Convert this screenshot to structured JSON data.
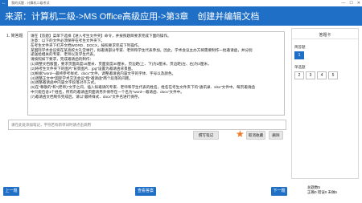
{
  "window": {
    "back_glyph": "←",
    "title": "我的试题 - 计算机二级考试",
    "minimize": "—",
    "maximize": "☐",
    "close": "✕"
  },
  "header": {
    "title": "来源：计算机二级->MS Office高级应用->第3章　创建并编辑文档"
  },
  "question": {
    "number": "1. 简答题",
    "lines": [
      "请在【答题】菜单下选择【进入考生文件夹】命令，并按照题目要求完成下面的操作。",
      "注意：以下的文件必须保存在考生文件夹下。",
      "在考生文件夹下打开文档WORD．DOCX，按照要求完成下列操作。",
      "某国际学术会议将在某高校大礼堂举行，拟邀请部分专家、老师和学生代表参加。因此，学术会议主办方将需要制作一批邀请函，并分别",
      "递送给相关的专家、老师以及学生代表。",
      "请按照如下要求，完成邀请函的制作：",
      "(1)调整文档版面，要求页面高度18厘米、页面宽度30厘米，页边距(上、下)为2厘米，页边距(左、右)为3厘米。",
      "(2)将考生文件夹下的图片\"背景图片．jpg\"设置为邀请函背景图。",
      "(3)根据\"word—最终参考样式．docx\"文件，调整邀请函内容文字的字体、字号以及颜色。",
      "(4)调整正文中\"国际学术交流会议\"和\"邀请函\"两个段落的间距。",
      "(5)调整邀请函中内容文字段落对齐方式。",
      "(6)在\"尊敬的\"和\"(老师)\"文字之间，插入拟邀请的专家、老师和学生代表的姓名，姓名在考生文件夹下的\"通讯录．xlsx\"文件中。每页邀请函",
      "中只能包含1个姓名，所有的邀请函页面请另外保存在一个名为\"word—邀请函．docx\"文件中。",
      "(7)邀请函文档制作完成后，请以\"最终样式．docx\"文件名进行保存。"
    ]
  },
  "note": {
    "placeholder": "请在此处添加笔记，字符若有新单词时请点击调用"
  },
  "actions": {
    "write_note": "撰写笔记",
    "cancel_favorite": "取消收藏",
    "delete": "删除"
  },
  "answer_card": {
    "title": "答题卡",
    "section1_label": "简答题",
    "section1_items": [
      "1"
    ],
    "section2_label": "单选题",
    "section2_items": [
      "2",
      "3",
      "4",
      "5"
    ]
  },
  "footer": {
    "prev": "上一题",
    "view_answer": "查看答案",
    "next": "下一题",
    "stat_total": "总题数5",
    "stat_result": "正确0 错误0 未做5"
  },
  "colors": {
    "primary": "#1f6fc7",
    "star": "#f07828"
  }
}
